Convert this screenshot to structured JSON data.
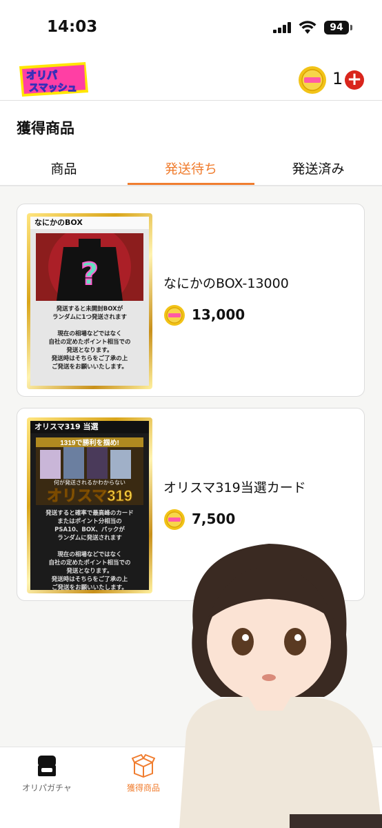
{
  "status_bar": {
    "time": "14:03",
    "battery": "94"
  },
  "header": {
    "logo_text": "オリパスマッシュ",
    "coin_count": "1",
    "add_symbol": "+",
    "coin_badge_text": "オリパスマッシュ"
  },
  "page": {
    "title": "獲得商品"
  },
  "tabs": [
    {
      "label": "商品",
      "active": false
    },
    {
      "label": "発送待ち",
      "active": true
    },
    {
      "label": "発送済み",
      "active": false
    }
  ],
  "items": [
    {
      "thumb_label": "なにかのBOX",
      "thumb_text": "発送すると未開封BOXが\nランダムに1つ発送されます\n\n現在の相場などではなく\n自社の定めたポイント相当での\n発送となります。\n発送時はそちらをご了承の上\nご発送をお願いいたします。",
      "name": "なにかのBOX-13000",
      "price": "13,000"
    },
    {
      "thumb_label": "オリスマ319 当選",
      "thumb_banner": "1319で勝利を掴め!",
      "thumb_title": "オリスマ319",
      "thumb_subtitle": "何が発送されるかわからない",
      "thumb_text": "発送すると確率で最高峰のカード\nまたはポイント分相当の\nPSA10、BOX、パックが\nランダムに発送されます\n\n現在の相場などではなく\n自社の定めたポイント相当での\n発送となります。\n発送時はそちらをご了承の上\nご発送をお願いいたします。",
      "name": "オリスマ319当選カード",
      "price": "7,500"
    }
  ],
  "nav": [
    {
      "label": "オリパガチャ",
      "icon": "gacha-machine-icon",
      "active": false
    },
    {
      "label": "獲得商品",
      "icon": "box-icon",
      "active": true
    }
  ],
  "colors": {
    "accent": "#f07d2f",
    "add_button": "#d9251c",
    "coin": "#f2c318"
  }
}
